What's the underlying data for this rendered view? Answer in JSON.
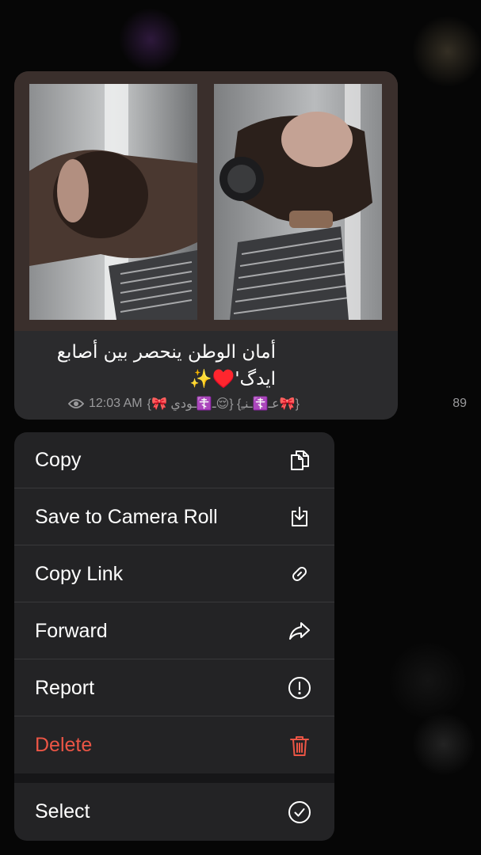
{
  "message": {
    "caption_line1": "أمان الوطن ينحصر بين أصابع",
    "caption_line2": "ايدگ'♥️✨",
    "views": "89",
    "author": "{🎀عـ☦️ـنـِ} {😌ـ☦️ـودي 🎀}",
    "time": "12:03 AM"
  },
  "menu": {
    "copy": "Copy",
    "save": "Save to Camera Roll",
    "copy_link": "Copy Link",
    "forward": "Forward",
    "report": "Report",
    "delete": "Delete",
    "select": "Select"
  },
  "icons": {
    "copy": "copy-icon",
    "save": "download-icon",
    "copy_link": "link-icon",
    "forward": "forward-arrow-icon",
    "report": "exclamation-circle-icon",
    "delete": "trash-icon",
    "select": "checkmark-circle-icon"
  },
  "colors": {
    "destructive": "#eb5545",
    "menu_bg": "#232325",
    "bubble_bg": "#2b2b2d"
  }
}
